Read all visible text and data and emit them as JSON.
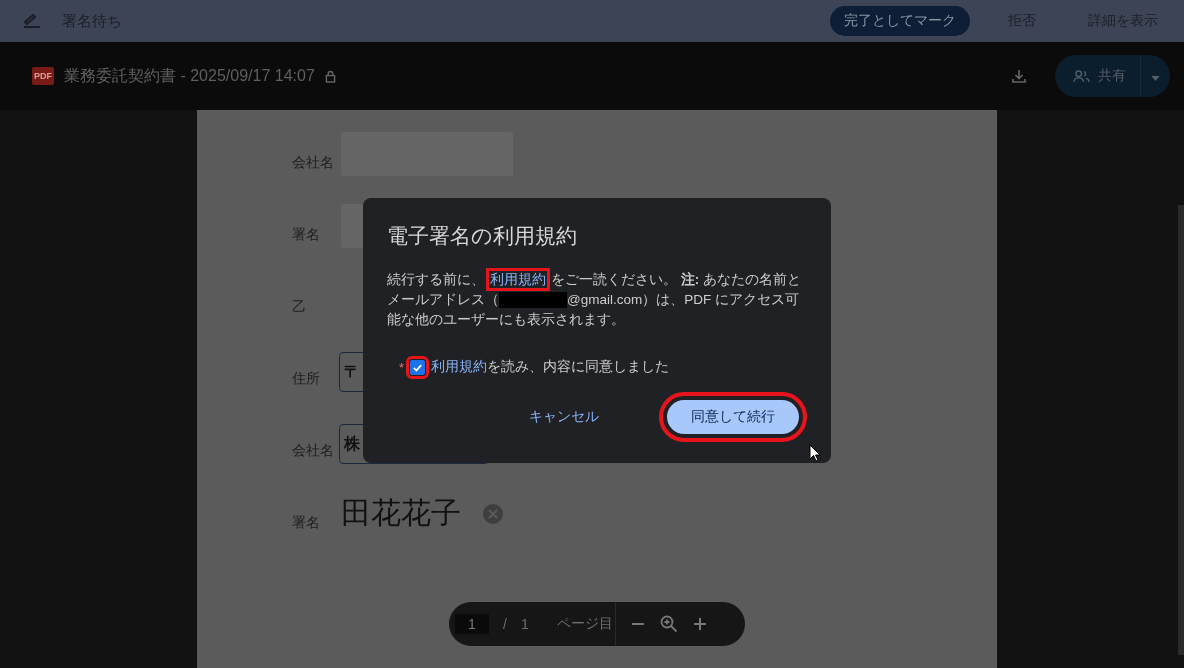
{
  "header": {
    "title": "署名待ち",
    "actions": [
      {
        "label": "完了としてマーク",
        "kind": "primary"
      },
      {
        "label": "拒否",
        "kind": "text"
      },
      {
        "label": "詳細を表示",
        "kind": "text"
      }
    ]
  },
  "doc_bar": {
    "badge": "PDF",
    "title": "業務委託契約書 - 2025/09/17 14:07",
    "share_label": "共有"
  },
  "form": {
    "fields": [
      {
        "label": "会社名",
        "kind": "blank"
      },
      {
        "label": "署名",
        "kind": "blank"
      },
      {
        "label": "乙",
        "kind": "none"
      },
      {
        "label": "住所",
        "kind": "input",
        "value": "〒"
      },
      {
        "label": "会社名",
        "kind": "input",
        "value": "株"
      },
      {
        "label": "署名",
        "kind": "signature",
        "value": "田花花子"
      }
    ]
  },
  "dialog": {
    "title": "電子署名の利用規約",
    "text_before": "続行する前に、",
    "link": "利用規約",
    "link_highlighted": true,
    "text_middle": "をご一読ください。 **注:** あなたの名前とメールアドレス（",
    "email_suffix": "@gmail.com）は、PDF にアクセス可能な他のユーザーにも表示されます。",
    "consent": {
      "required_mark": "*",
      "checked": true,
      "highlighted": true,
      "link": "利用規約",
      "label": "を読み、内容に同意しました"
    },
    "buttons": [
      {
        "label": "キャンセル",
        "kind": "text",
        "highlighted": false
      },
      {
        "label": "同意して続行",
        "kind": "primary",
        "highlighted": true
      }
    ]
  },
  "pager": {
    "page": "1",
    "separator": "/",
    "total": "1",
    "unit": "ページ目"
  }
}
